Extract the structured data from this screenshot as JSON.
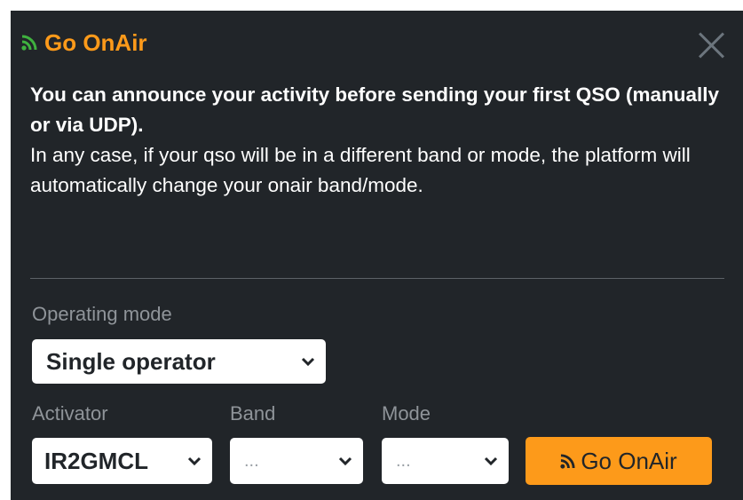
{
  "header": {
    "title": "Go OnAir",
    "icon": "rss-icon",
    "icon_color": "#3fb23f"
  },
  "intro": {
    "bold_text": "You can announce your activity before sending your first QSO (manually or via UDP).",
    "text": "In any case, if your qso will be in a different band or mode, the platform will automatically change your onair band/mode."
  },
  "form": {
    "operating_mode_label": "Operating mode",
    "operating_mode_value": "Single operator",
    "activator_label": "Activator",
    "activator_value": "IR2GMCL",
    "band_label": "Band",
    "band_value": "...",
    "mode_label": "Mode",
    "mode_value": "..."
  },
  "button": {
    "label": "Go OnAir"
  },
  "colors": {
    "accent": "#fd9a1a",
    "panel": "#212529",
    "muted": "#8f9499"
  }
}
